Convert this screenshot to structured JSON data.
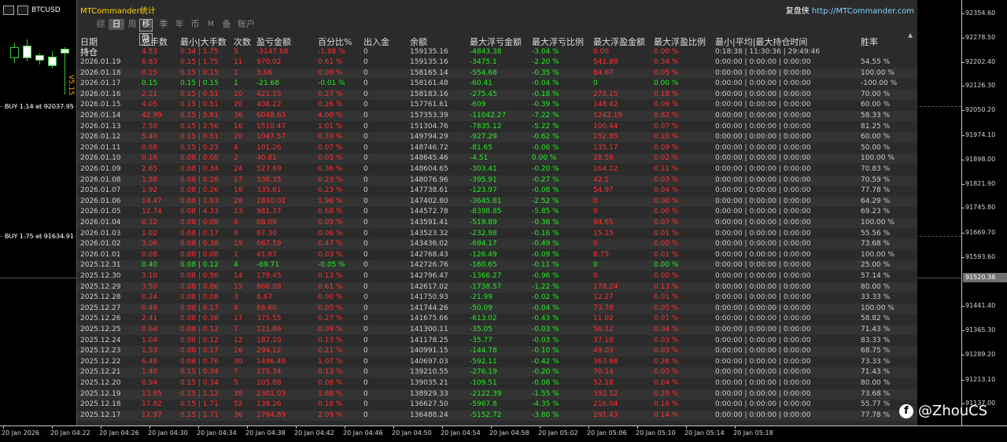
{
  "window": {
    "symbol": "BTCUSD",
    "side_label": "V5.15"
  },
  "panel": {
    "title": "MTCommander统计",
    "brand_prefix": "复盘侠",
    "brand_url": "http://MTCommander.com",
    "side_buttons": [
      "移",
      "隐"
    ],
    "tabs": [
      {
        "label": "综",
        "active": false
      },
      {
        "label": "日",
        "active": true
      },
      {
        "label": "周",
        "active": false
      },
      {
        "label": "月",
        "active": false
      },
      {
        "label": "季",
        "active": false
      },
      {
        "label": "年",
        "active": false
      },
      {
        "label": "币",
        "active": false
      },
      {
        "label": "M",
        "active": false
      },
      {
        "label": "备",
        "active": false
      },
      {
        "label": "账户",
        "active": false
      }
    ],
    "headers": [
      "日期",
      "总手数",
      "最小|大手数",
      "次数",
      "盈亏金额",
      "百分比%",
      "出入金",
      "余额",
      "最大浮亏金额",
      "最大浮亏比例",
      "最大浮盈金额",
      "最大浮盈比例",
      "最小|平均|最大持仓时间",
      "胜率"
    ],
    "total": {
      "date": "持仓",
      "lots": "4.53",
      "minmax": "0.34 | 1.75",
      "count": "5",
      "pnl": "-3147.68",
      "pct": "-1.98 %",
      "io": "0",
      "bal": "159135.16",
      "mfl": "-4843.38",
      "mflp": "-3.04 %",
      "mfp": "0.00",
      "mfpp": "0.00 %",
      "hold": "0:18:38 | 11:30:36 | 29:49:46",
      "win": "",
      "dir": "down"
    },
    "rows": [
      {
        "date": "2026.01.19",
        "lots": "6.83",
        "minmax": "0.15 | 1.75",
        "count": "11",
        "pnl": "970.02",
        "pct": "0.61 %",
        "io": "0",
        "bal": "159135.16",
        "mfl": "-3475.1",
        "mflp": "-2.20 %",
        "mfp": "541.88",
        "mfpp": "0.34 %",
        "hold": "0:00:00 | 0:00:00 | 0:00:00",
        "win": "54.55 %",
        "dir": "down"
      },
      {
        "date": "2026.01.18",
        "lots": "0.15",
        "minmax": "0.15 | 0.15",
        "count": "1",
        "pnl": "3.66",
        "pct": "0.00 %",
        "io": "0",
        "bal": "158165.14",
        "mfl": "-554.68",
        "mflp": "-0.35 %",
        "mfp": "84.67",
        "mfpp": "0.05 %",
        "hold": "0:00:00 | 0:00:00 | 0:00:00",
        "win": "100.00 %",
        "dir": "down"
      },
      {
        "date": "2026.01.17",
        "lots": "0.15",
        "minmax": "0.15 | 0.15",
        "count": "1",
        "pnl": "-21.68",
        "pct": "-0.01 %",
        "io": "0",
        "bal": "158161.48",
        "mfl": "-60.41",
        "mflp": "-0.04 %",
        "mfp": "0",
        "mfpp": "0.00 %",
        "hold": "0:00:00 | 0:00:00 | 0:00:00",
        "win": "-100.00 %",
        "dir": "up"
      },
      {
        "date": "2026.01.16",
        "lots": "2.21",
        "minmax": "0.15 | 0.51",
        "count": "10",
        "pnl": "421.55",
        "pct": "0.27 %",
        "io": "0",
        "bal": "158183.16",
        "mfl": "-275.45",
        "mflp": "-0.18 %",
        "mfp": "278.15",
        "mfpp": "0.18 %",
        "hold": "0:00:00 | 0:00:00 | 0:00:00",
        "win": "70.00 %",
        "dir": "down"
      },
      {
        "date": "2026.01.15",
        "lots": "4.05",
        "minmax": "0.15 | 0.51",
        "count": "20",
        "pnl": "408.22",
        "pct": "0.26 %",
        "io": "0",
        "bal": "157761.61",
        "mfl": "-609",
        "mflp": "-0.39 %",
        "mfp": "148.42",
        "mfpp": "0.09 %",
        "hold": "0:00:00 | 0:00:00 | 0:00:00",
        "win": "60.00 %",
        "dir": "down"
      },
      {
        "date": "2026.01.14",
        "lots": "42.99",
        "minmax": "0.15 | 5.81",
        "count": "36",
        "pnl": "6048.63",
        "pct": "4.00 %",
        "io": "0",
        "bal": "157353.39",
        "mfl": "-11042.27",
        "mflp": "-7.22 %",
        "mfp": "1242.19",
        "mfpp": "0.82 %",
        "hold": "0:00:00 | 0:00:00 | 0:00:00",
        "win": "58.33 %",
        "dir": "down"
      },
      {
        "date": "2026.01.13",
        "lots": "7.50",
        "minmax": "0.15 | 2.56",
        "count": "16",
        "pnl": "1510.47",
        "pct": "1.01 %",
        "io": "0",
        "bal": "151304.76",
        "mfl": "-7835.12",
        "mflp": "-5.22 %",
        "mfp": "100.44",
        "mfpp": "0.07 %",
        "hold": "0:00:00 | 0:00:00 | 0:00:00",
        "win": "81.25 %",
        "dir": "down"
      },
      {
        "date": "2026.01.12",
        "lots": "5.40",
        "minmax": "0.15 | 0.51",
        "count": "20",
        "pnl": "1047.57",
        "pct": "0.70 %",
        "io": "0",
        "bal": "149794.29",
        "mfl": "-927.29",
        "mflp": "-0.62 %",
        "mfp": "152.85",
        "mfpp": "0.10 %",
        "hold": "0:00:00 | 0:00:00 | 0:00:00",
        "win": "60.00 %",
        "dir": "down"
      },
      {
        "date": "2026.01.11",
        "lots": "0.68",
        "minmax": "0.15 | 0.23",
        "count": "4",
        "pnl": "101.26",
        "pct": "0.07 %",
        "io": "0",
        "bal": "148746.72",
        "mfl": "-81.65",
        "mflp": "-0.06 %",
        "mfp": "135.17",
        "mfpp": "0.09 %",
        "hold": "0:00:00 | 0:00:00 | 0:00:00",
        "win": "50.00 %",
        "dir": "down"
      },
      {
        "date": "2026.01.10",
        "lots": "0.16",
        "minmax": "0.08 | 0.08",
        "count": "2",
        "pnl": "40.81",
        "pct": "0.03 %",
        "io": "0",
        "bal": "148645.46",
        "mfl": "-4.51",
        "mflp": "0.00 %",
        "mfp": "28.58",
        "mfpp": "0.02 %",
        "hold": "0:00:00 | 0:00:00 | 0:00:00",
        "win": "100.00 %",
        "dir": "down"
      },
      {
        "date": "2026.01.09",
        "lots": "2.65",
        "minmax": "0.08 | 0.34",
        "count": "24",
        "pnl": "527.69",
        "pct": "0.36 %",
        "io": "0",
        "bal": "148604.65",
        "mfl": "-303.41",
        "mflp": "-0.20 %",
        "mfp": "164.12",
        "mfpp": "0.11 %",
        "hold": "0:00:00 | 0:00:00 | 0:00:00",
        "win": "70.83 %",
        "dir": "down"
      },
      {
        "date": "2026.01.08",
        "lots": "1.88",
        "minmax": "0.08 | 0.26",
        "count": "17",
        "pnl": "338.35",
        "pct": "0.23 %",
        "io": "0",
        "bal": "148076.96",
        "mfl": "-395.91",
        "mflp": "-0.27 %",
        "mfp": "42.1",
        "mfpp": "0.03 %",
        "hold": "0:00:00 | 0:00:00 | 0:00:00",
        "win": "70.59 %",
        "dir": "down"
      },
      {
        "date": "2026.01.07",
        "lots": "1.92",
        "minmax": "0.08 | 0.26",
        "count": "18",
        "pnl": "335.81",
        "pct": "0.23 %",
        "io": "0",
        "bal": "147738.61",
        "mfl": "-123.97",
        "mflp": "-0.08 %",
        "mfp": "54.97",
        "mfpp": "0.04 %",
        "hold": "0:00:00 | 0:00:00 | 0:00:00",
        "win": "77.78 %",
        "dir": "down"
      },
      {
        "date": "2026.01.06",
        "lots": "14.47",
        "minmax": "0.08 | 1.93",
        "count": "28",
        "pnl": "2830.02",
        "pct": "1.96 %",
        "io": "0",
        "bal": "147402.80",
        "mfl": "-3645.81",
        "mflp": "-2.52 %",
        "mfp": "0",
        "mfpp": "0.00 %",
        "hold": "0:00:00 | 0:00:00 | 0:00:00",
        "win": "64.29 %",
        "dir": "down"
      },
      {
        "date": "2026.01.05",
        "lots": "12.74",
        "minmax": "0.08 | 4.33",
        "count": "13",
        "pnl": "981.37",
        "pct": "0.68 %",
        "io": "0",
        "bal": "144572.78",
        "mfl": "-8398.85",
        "mflp": "-5.85 %",
        "mfp": "0",
        "mfpp": "0.00 %",
        "hold": "0:00:00 | 0:00:00 | 0:00:00",
        "win": "69.23 %",
        "dir": "down"
      },
      {
        "date": "2026.01.04",
        "lots": "0.32",
        "minmax": "0.08 | 0.08",
        "count": "4",
        "pnl": "68.09",
        "pct": "0.05 %",
        "io": "0",
        "bal": "143591.41",
        "mfl": "-519.89",
        "mflp": "-0.36 %",
        "mfp": "94.65",
        "mfpp": "0.07 %",
        "hold": "0:00:00 | 0:00:00 | 0:00:00",
        "win": "100.00 %",
        "dir": "down"
      },
      {
        "date": "2026.01.03",
        "lots": "1.02",
        "minmax": "0.08 | 0.17",
        "count": "9",
        "pnl": "87.30",
        "pct": "0.06 %",
        "io": "0",
        "bal": "143523.32",
        "mfl": "-232.98",
        "mflp": "-0.16 %",
        "mfp": "15.15",
        "mfpp": "0.01 %",
        "hold": "0:00:00 | 0:00:00 | 0:00:00",
        "win": "55.56 %",
        "dir": "down"
      },
      {
        "date": "2026.01.02",
        "lots": "3.06",
        "minmax": "0.08 | 0.38",
        "count": "19",
        "pnl": "667.59",
        "pct": "0.47 %",
        "io": "0",
        "bal": "143436.02",
        "mfl": "-694.17",
        "mflp": "-0.49 %",
        "mfp": "0",
        "mfpp": "0.00 %",
        "hold": "0:00:00 | 0:00:00 | 0:00:00",
        "win": "73.68 %",
        "dir": "down"
      },
      {
        "date": "2026.01.01",
        "lots": "0.08",
        "minmax": "0.08 | 0.08",
        "count": "1",
        "pnl": "41.67",
        "pct": "0.03 %",
        "io": "0",
        "bal": "142768.43",
        "mfl": "-126.49",
        "mflp": "-0.09 %",
        "mfp": "8.75",
        "mfpp": "0.01 %",
        "hold": "0:00:00 | 0:00:00 | 0:00:00",
        "win": "100.00 %",
        "dir": "down"
      },
      {
        "date": "2025.12.31",
        "lots": "0.40",
        "minmax": "0.08 | 0.12",
        "count": "4",
        "pnl": "-69.71",
        "pct": "-0.05 %",
        "io": "0",
        "bal": "142726.76",
        "mfl": "-160.65",
        "mflp": "-0.11 %",
        "mfp": "0",
        "mfpp": "0.00 %",
        "hold": "0:00:00 | 0:00:00 | 0:00:00",
        "win": "25.00 %",
        "dir": "up"
      },
      {
        "date": "2025.12.30",
        "lots": "3.10",
        "minmax": "0.08 | 0.56",
        "count": "14",
        "pnl": "179.45",
        "pct": "0.13 %",
        "io": "0",
        "bal": "142796.47",
        "mfl": "-1366.27",
        "mflp": "-0.96 %",
        "mfp": "0",
        "mfpp": "0.00 %",
        "hold": "0:00:00 | 0:00:00 | 0:00:00",
        "win": "57.14 %",
        "dir": "down"
      },
      {
        "date": "2025.12.29",
        "lots": "3.50",
        "minmax": "0.08 | 0.86",
        "count": "15",
        "pnl": "866.09",
        "pct": "0.61 %",
        "io": "0",
        "bal": "142617.02",
        "mfl": "-1738.57",
        "mflp": "-1.22 %",
        "mfp": "178.24",
        "mfpp": "0.13 %",
        "hold": "0:00:00 | 0:00:00 | 0:00:00",
        "win": "80.00 %",
        "dir": "down"
      },
      {
        "date": "2025.12.28",
        "lots": "0.24",
        "minmax": "0.08 | 0.08",
        "count": "3",
        "pnl": "6.67",
        "pct": "0.00 %",
        "io": "0",
        "bal": "141750.93",
        "mfl": "-21.99",
        "mflp": "-0.02 %",
        "mfp": "12.27",
        "mfpp": "0.01 %",
        "hold": "0:00:00 | 0:00:00 | 0:00:00",
        "win": "33.33 %",
        "dir": "down"
      },
      {
        "date": "2025.12.27",
        "lots": "0.49",
        "minmax": "0.08 | 0.17",
        "count": "4",
        "pnl": "68.60",
        "pct": "0.05 %",
        "io": "0",
        "bal": "141744.26",
        "mfl": "-50.09",
        "mflp": "-0.04 %",
        "mfp": "73.78",
        "mfpp": "0.05 %",
        "hold": "0:00:00 | 0:00:00 | 0:00:00",
        "win": "100.00 %",
        "dir": "down"
      },
      {
        "date": "2025.12.26",
        "lots": "2.41",
        "minmax": "0.08 | 0.38",
        "count": "17",
        "pnl": "375.55",
        "pct": "0.27 %",
        "io": "0",
        "bal": "141675.66",
        "mfl": "-613.02",
        "mflp": "-0.43 %",
        "mfp": "11.02",
        "mfpp": "0.01 %",
        "hold": "0:00:00 | 0:00:00 | 0:00:00",
        "win": "58.82 %",
        "dir": "down"
      },
      {
        "date": "2025.12.25",
        "lots": "0.64",
        "minmax": "0.08 | 0.12",
        "count": "7",
        "pnl": "121.86",
        "pct": "0.09 %",
        "io": "0",
        "bal": "141300.11",
        "mfl": "-35.05",
        "mflp": "-0.03 %",
        "mfp": "56.12",
        "mfpp": "0.04 %",
        "hold": "0:00:00 | 0:00:00 | 0:00:00",
        "win": "71.43 %",
        "dir": "down"
      },
      {
        "date": "2025.12.24",
        "lots": "1.04",
        "minmax": "0.08 | 0.12",
        "count": "12",
        "pnl": "187.10",
        "pct": "0.13 %",
        "io": "0",
        "bal": "141178.25",
        "mfl": "-35.77",
        "mflp": "-0.03 %",
        "mfp": "37.18",
        "mfpp": "0.03 %",
        "hold": "0:00:00 | 0:00:00 | 0:00:00",
        "win": "83.33 %",
        "dir": "down"
      },
      {
        "date": "2025.12.23",
        "lots": "1.53",
        "minmax": "0.08 | 0.17",
        "count": "16",
        "pnl": "294.12",
        "pct": "0.21 %",
        "io": "0",
        "bal": "140991.15",
        "mfl": "-144.78",
        "mflp": "-0.10 %",
        "mfp": "49.03",
        "mfpp": "0.03 %",
        "hold": "0:00:00 | 0:00:00 | 0:00:00",
        "win": "68.75 %",
        "dir": "down"
      },
      {
        "date": "2025.12.22",
        "lots": "6.48",
        "minmax": "0.08 | 0.76",
        "count": "30",
        "pnl": "1486.48",
        "pct": "1.07 %",
        "io": "0",
        "bal": "140697.03",
        "mfl": "-592.11",
        "mflp": "-0.42 %",
        "mfp": "363.68",
        "mfpp": "0.26 %",
        "hold": "0:00:00 | 0:00:00 | 0:00:00",
        "win": "73.33 %",
        "dir": "down"
      },
      {
        "date": "2025.12.21",
        "lots": "1.40",
        "minmax": "0.15 | 0.34",
        "count": "7",
        "pnl": "175.34",
        "pct": "0.13 %",
        "io": "0",
        "bal": "139210.55",
        "mfl": "-276.19",
        "mflp": "-0.20 %",
        "mfp": "70.14",
        "mfpp": "0.05 %",
        "hold": "0:00:00 | 0:00:00 | 0:00:00",
        "win": "71.43 %",
        "dir": "down"
      },
      {
        "date": "2025.12.20",
        "lots": "0.94",
        "minmax": "0.15 | 0.34",
        "count": "5",
        "pnl": "105.88",
        "pct": "0.08 %",
        "io": "0",
        "bal": "139035.21",
        "mfl": "-109.51",
        "mflp": "-0.08 %",
        "mfp": "52.18",
        "mfpp": "0.04 %",
        "hold": "0:00:00 | 0:00:00 | 0:00:00",
        "win": "80.00 %",
        "dir": "down"
      },
      {
        "date": "2025.12.19",
        "lots": "13.95",
        "minmax": "0.15 | 1.12",
        "count": "38",
        "pnl": "2301.03",
        "pct": "1.68 %",
        "io": "0",
        "bal": "138929.33",
        "mfl": "-2122.39",
        "mflp": "-1.55 %",
        "mfp": "392.12",
        "mfpp": "0.29 %",
        "hold": "0:00:00 | 0:00:00 | 0:00:00",
        "win": "73.68 %",
        "dir": "down"
      },
      {
        "date": "2025.12.18",
        "lots": "17.82",
        "minmax": "0.15 | 1.71",
        "count": "52",
        "pnl": "139.26",
        "pct": "0.10 %",
        "io": "0",
        "bal": "136627.50",
        "mfl": "-5967.8",
        "mflp": "-4.35 %",
        "mfp": "216.04",
        "mfpp": "0.16 %",
        "hold": "0:00:00 | 0:00:00 | 0:00:00",
        "win": "55.77 %",
        "dir": "down"
      },
      {
        "date": "2025.12.17",
        "lots": "12.97",
        "minmax": "0.15 | 1.71",
        "count": "36",
        "pnl": "2794.89",
        "pct": "2.09 %",
        "io": "0",
        "bal": "136488.24",
        "mfl": "-5152.72",
        "mflp": "-3.80 %",
        "mfp": "191.43",
        "mfpp": "0.14 %",
        "hold": "0:00:00 | 0:00:00 | 0:00:00",
        "win": "77.78 %",
        "dir": "down"
      }
    ]
  },
  "price_axis": {
    "labels": [
      "92354.60",
      "92278.50",
      "92202.40",
      "92126.30",
      "92050.20",
      "91974.10",
      "91898.00",
      "91821.90",
      "91745.80",
      "91669.70",
      "91593.60",
      "91441.40",
      "91365.30",
      "91289.20",
      "91213.10",
      "91137.00"
    ],
    "current_price": "91520.38"
  },
  "time_axis": {
    "labels": [
      "20 Jan 2026",
      "20 Jan 04:22",
      "20 Jan 04:26",
      "20 Jan 04:30",
      "20 Jan 04:34",
      "20 Jan 04:38",
      "20 Jan 04:42",
      "20 Jan 04:46",
      "20 Jan 04:50",
      "20 Jan 04:54",
      "20 Jan 04:58",
      "20 Jan 05:02",
      "20 Jan 05:06",
      "20 Jan 05:10",
      "20 Jan 05:14",
      "20 Jan 05:18"
    ]
  },
  "chart_labels": {
    "buy1": "BUY 1.14 at 92037.95",
    "buy2": "BUY 1.75 at 91634.91"
  },
  "watermark": {
    "text": "@ZhouCS",
    "icon": "facebook-icon"
  },
  "colors": {
    "up": "#22ee22",
    "down": "#ff3030",
    "panel_bg": "#2b2b2b",
    "title": "#ffd000"
  }
}
